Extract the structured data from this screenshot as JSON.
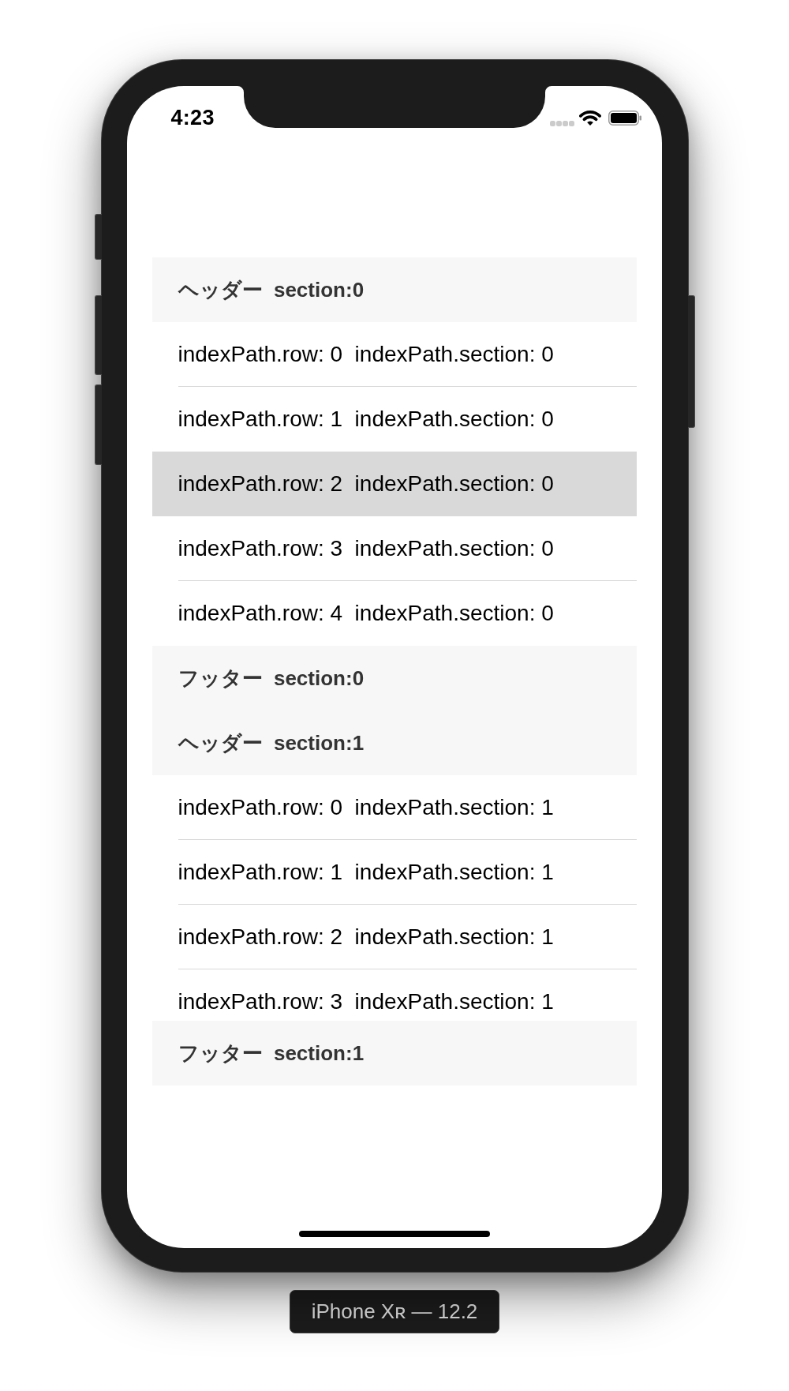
{
  "status_bar": {
    "time": "4:23"
  },
  "table": {
    "sections": [
      {
        "header": "ヘッダー  section:0",
        "rows": [
          {
            "text": "indexPath.row: 0  indexPath.section: 0",
            "selected": false
          },
          {
            "text": "indexPath.row: 1  indexPath.section: 0",
            "selected": false
          },
          {
            "text": "indexPath.row: 2  indexPath.section: 0",
            "selected": true
          },
          {
            "text": "indexPath.row: 3  indexPath.section: 0",
            "selected": false
          },
          {
            "text": "indexPath.row: 4  indexPath.section: 0",
            "selected": false
          }
        ],
        "footer": "フッター  section:0"
      },
      {
        "header": "ヘッダー  section:1",
        "rows": [
          {
            "text": "indexPath.row: 0  indexPath.section: 1",
            "selected": false
          },
          {
            "text": "indexPath.row: 1  indexPath.section: 1",
            "selected": false
          },
          {
            "text": "indexPath.row: 2  indexPath.section: 1",
            "selected": false
          },
          {
            "text": "indexPath.row: 3  indexPath.section: 1",
            "selected": false
          }
        ],
        "footer": "フッター  section:1"
      }
    ]
  },
  "device_label": "iPhone Xʀ — 12.2"
}
